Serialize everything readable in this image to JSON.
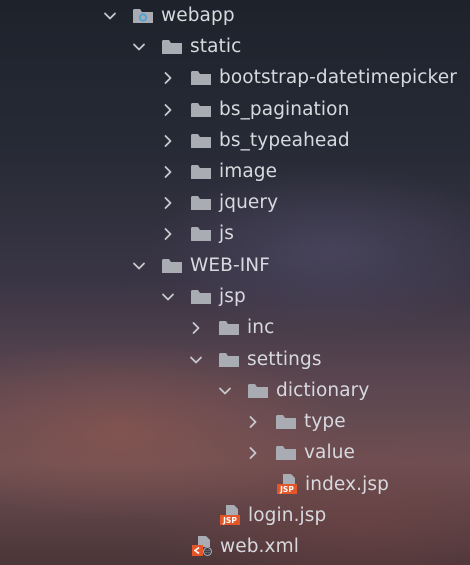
{
  "tree": {
    "rows": [
      {
        "label": "webapp",
        "expanded": true,
        "icon": "web-folder-icon"
      },
      {
        "label": "static",
        "expanded": true,
        "icon": "folder-icon"
      },
      {
        "label": "bootstrap-datetimepicker",
        "expanded": false,
        "icon": "folder-icon"
      },
      {
        "label": "bs_pagination",
        "expanded": false,
        "icon": "folder-icon"
      },
      {
        "label": "bs_typeahead",
        "expanded": false,
        "icon": "folder-icon"
      },
      {
        "label": "image",
        "expanded": false,
        "icon": "folder-icon"
      },
      {
        "label": "jquery",
        "expanded": false,
        "icon": "folder-icon"
      },
      {
        "label": "js",
        "expanded": false,
        "icon": "folder-icon"
      },
      {
        "label": "WEB-INF",
        "expanded": true,
        "icon": "folder-icon"
      },
      {
        "label": "jsp",
        "expanded": true,
        "icon": "folder-icon"
      },
      {
        "label": "inc",
        "expanded": false,
        "icon": "folder-icon"
      },
      {
        "label": "settings",
        "expanded": true,
        "icon": "folder-icon"
      },
      {
        "label": "dictionary",
        "expanded": true,
        "icon": "folder-icon"
      },
      {
        "label": "type",
        "expanded": false,
        "icon": "folder-icon"
      },
      {
        "label": "value",
        "expanded": false,
        "icon": "folder-icon"
      },
      {
        "label": "index.jsp",
        "icon": "jsp-file-icon"
      },
      {
        "label": "login.jsp",
        "icon": "jsp-file-icon"
      },
      {
        "label": "web.xml",
        "icon": "xml-file-icon"
      }
    ]
  },
  "colors": {
    "text": "#d7d9df",
    "folder": "#a9acb3",
    "chevron": "#c8cad0",
    "jsp_badge": "#e2562a",
    "web_folder_accent": "#4aa3d9"
  }
}
